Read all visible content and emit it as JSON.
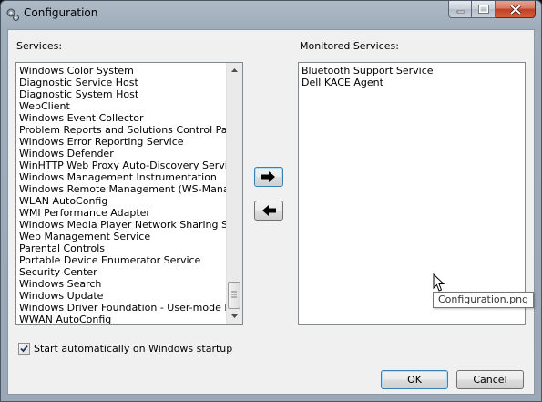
{
  "window": {
    "title": "Configuration"
  },
  "services": {
    "label": "Services:",
    "items": [
      "Windows Color System",
      "Diagnostic Service Host",
      "Diagnostic System Host",
      "WebClient",
      "Windows Event Collector",
      "Problem Reports and Solutions Control Panel Su",
      "Windows Error Reporting Service",
      "Windows Defender",
      "WinHTTP Web Proxy Auto-Discovery Service",
      "Windows Management Instrumentation",
      "Windows Remote Management (WS-Manageme",
      "WLAN AutoConfig",
      "WMI Performance Adapter",
      "Windows Media Player Network Sharing Service",
      "Web Management Service",
      "Parental Controls",
      "Portable Device Enumerator Service",
      "Security Center",
      "Windows Search",
      "Windows Update",
      "Windows Driver Foundation - User-mode Driver I",
      "WWAN AutoConfig"
    ]
  },
  "monitored": {
    "label": "Monitored Services:",
    "items": [
      "Bluetooth Support Service",
      "Dell KACE Agent"
    ]
  },
  "startup": {
    "label": "Start automatically on Windows startup",
    "checked": true
  },
  "buttons": {
    "ok": "OK",
    "cancel": "Cancel"
  },
  "tooltip": {
    "text": "Configuration.png"
  }
}
